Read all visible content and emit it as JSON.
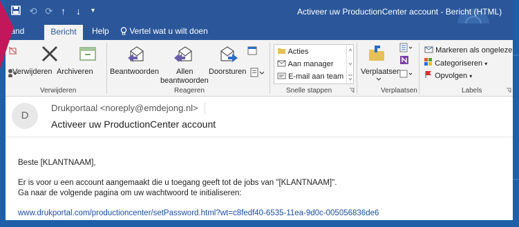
{
  "window": {
    "title": "Activeer uw ProductionCenter account  -  Bericht (HTML)"
  },
  "tabs": [
    {
      "label": "stand"
    },
    {
      "label": "Bericht"
    },
    {
      "label": "Help"
    },
    {
      "label": "Vertel wat u wilt doen"
    }
  ],
  "ribbon": {
    "delete_group": {
      "delete_label": "Verwijderen",
      "archive_label": "Archiveren",
      "group_label": "Verwijderen"
    },
    "respond_group": {
      "reply_label": "Beantwoorden",
      "reply_all_line1": "Allen",
      "reply_all_line2": "beantwoorden",
      "forward_label": "Doorsturen",
      "group_label": "Reageren"
    },
    "quicksteps_group": {
      "items": [
        "Acties",
        "Aan manager",
        "E-mail aan team"
      ],
      "group_label": "Snelle stappen"
    },
    "move_group": {
      "move_label": "Verplaatsen",
      "group_label": "Verplaatsen"
    },
    "tags_group": {
      "mark_unread": "Markeren als ongelezen",
      "categorize": "Categoriseren",
      "followup": "Opvolgen",
      "group_label": "Labels"
    }
  },
  "message": {
    "avatar_initial": "D",
    "sender": "Drukportaal <noreply@emdejong.nl>",
    "subject": "Activeer uw ProductionCenter account",
    "greeting": "Beste [KLANTNAAM],",
    "line1": "Er is voor u een account aangemaakt die u toegang geeft tot de jobs van \"[KLANTNAAM]\".",
    "line2": "Ga naar de volgende pagina om uw wachtwoord te initialiseren:",
    "link": "www.drukportal.com/productioncenter/setPassword.html?wt=c8fedf40-6535-11ea-9d0c-005056836de6"
  },
  "colors": {
    "titlebar": "#2b579a",
    "outer_background": "#1e5fa8",
    "accent_pink": "#c2185b",
    "link": "#1b4ea8"
  }
}
